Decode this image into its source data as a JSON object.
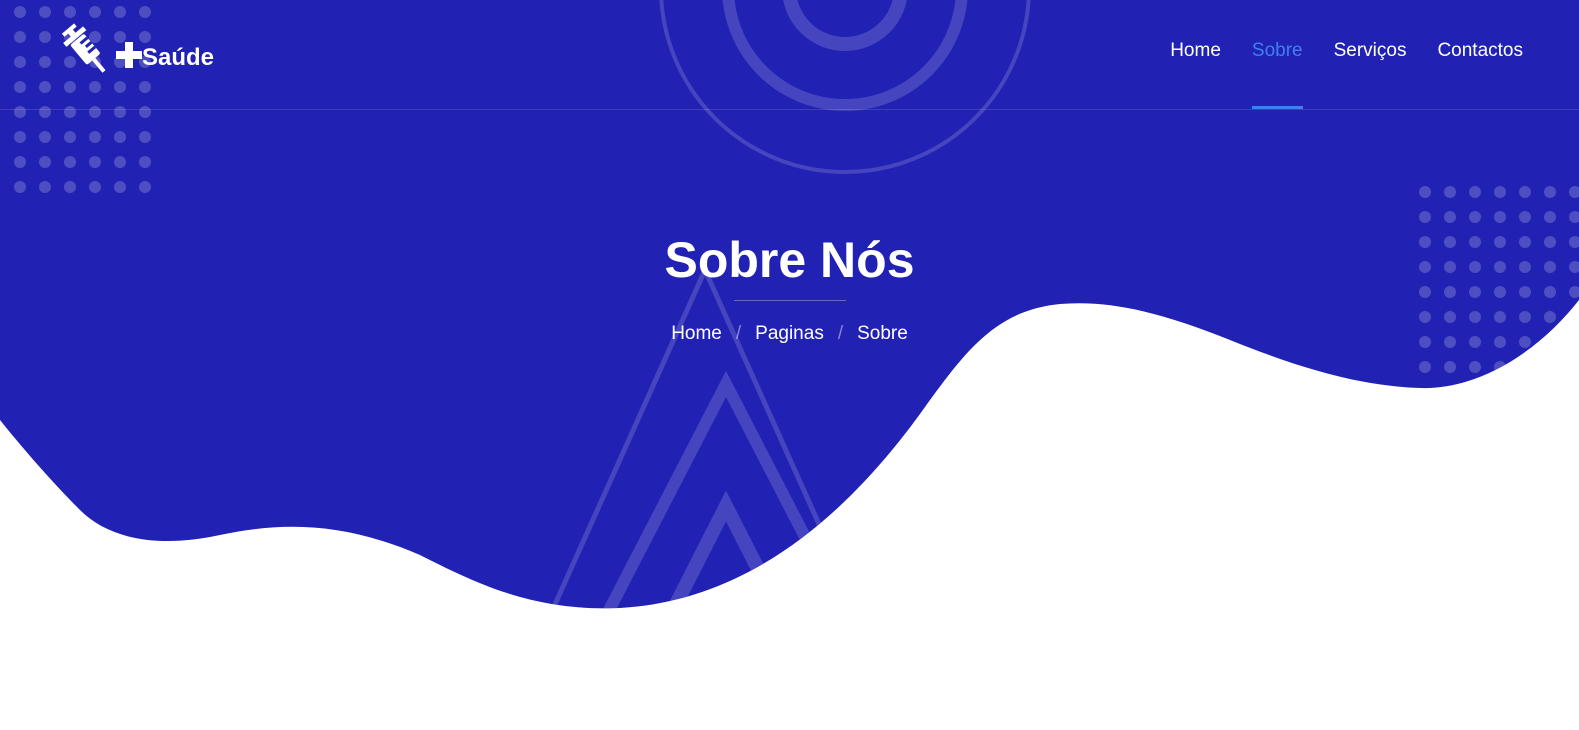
{
  "colors": {
    "hero_background": "#2122b3",
    "accent": "#3f7ff2",
    "text": "#ffffff",
    "page_background": "#ffffff"
  },
  "header": {
    "logo": {
      "icon": "syringe-icon",
      "plus_icon": "plus-icon",
      "text": "Saúde"
    },
    "nav": [
      {
        "label": "Home",
        "active": false
      },
      {
        "label": "Sobre",
        "active": true
      },
      {
        "label": "Serviços",
        "active": false
      },
      {
        "label": "Contactos",
        "active": false
      }
    ]
  },
  "hero": {
    "title": "Sobre Nós",
    "breadcrumb": [
      {
        "label": "Home"
      },
      {
        "label": "Paginas"
      },
      {
        "label": "Sobre"
      }
    ],
    "breadcrumb_separator": "/"
  }
}
